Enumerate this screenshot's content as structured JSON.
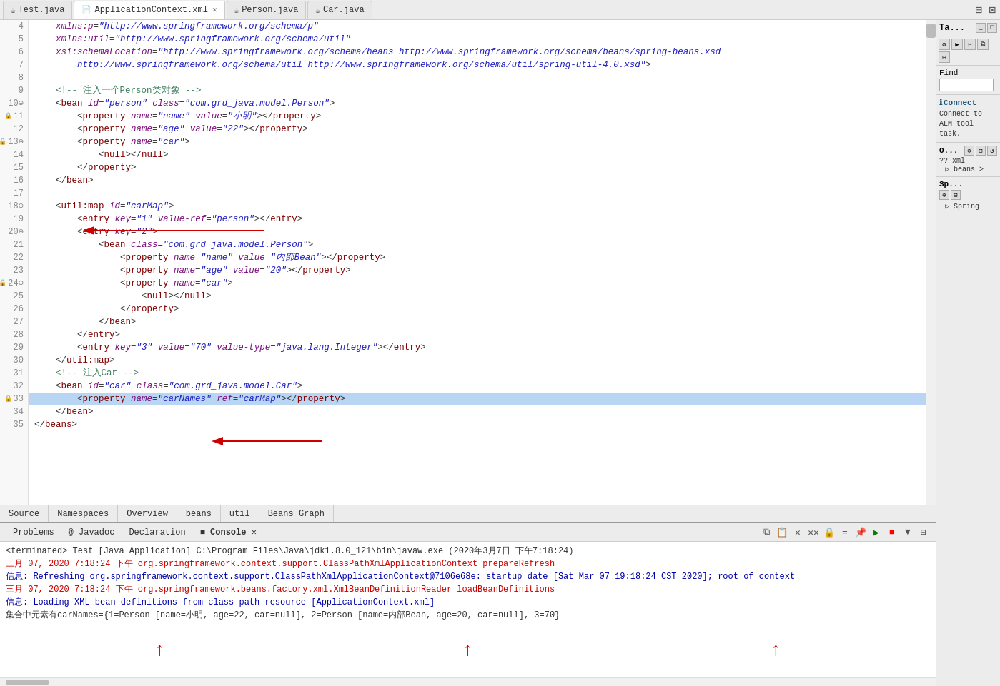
{
  "tabs": [
    {
      "id": "test-java",
      "label": "Test.java",
      "icon": "☕",
      "closable": false,
      "active": false
    },
    {
      "id": "app-context",
      "label": "ApplicationContext.xml",
      "icon": "📄",
      "closable": true,
      "active": true
    },
    {
      "id": "person-java",
      "label": "Person.java",
      "icon": "☕",
      "closable": false,
      "active": false
    },
    {
      "id": "car-java",
      "label": "Car.java",
      "icon": "☕",
      "closable": false,
      "active": false
    }
  ],
  "editor": {
    "lines": [
      {
        "num": 4,
        "marker": "",
        "text": "    xmlns:p=\"http://www.springframework.org/schema/p\""
      },
      {
        "num": 5,
        "marker": "",
        "text": "    xmlns:util=\"http://www.springframework.org/schema/util\""
      },
      {
        "num": 6,
        "marker": "",
        "text": "    xsi:schemaLocation=\"http://www.springframework.org/schema/beans http://www.springframework.org/schema/beans/spring-beans.xsd"
      },
      {
        "num": 7,
        "marker": "",
        "text": "    http://www.springframework.org/schema/util http://www.springframework.org/schema/util/spring-util-4.0.xsd\">"
      },
      {
        "num": 8,
        "marker": "",
        "text": ""
      },
      {
        "num": 9,
        "marker": "",
        "text": "    <!-- 注入一个Person类对象 -->"
      },
      {
        "num": 10,
        "marker": "",
        "text": "    <bean id=\"person\" class=\"com.grd_java.model.Person\">"
      },
      {
        "num": 11,
        "marker": "🔒",
        "text": "        <property name=\"name\" value=\"小明\"></property>"
      },
      {
        "num": 12,
        "marker": "",
        "text": "        <property name=\"age\" value=\"22\"></property>"
      },
      {
        "num": 13,
        "marker": "🔒",
        "text": "        <property name=\"car\">"
      },
      {
        "num": 14,
        "marker": "",
        "text": "            <null></null>"
      },
      {
        "num": 15,
        "marker": "",
        "text": "        </property>"
      },
      {
        "num": 16,
        "marker": "",
        "text": "    </bean>"
      },
      {
        "num": 17,
        "marker": "",
        "text": ""
      },
      {
        "num": 18,
        "marker": "",
        "text": "    <util:map id=\"carMap\">"
      },
      {
        "num": 19,
        "marker": "",
        "text": "        <entry key=\"1\" value-ref=\"person\"></entry>"
      },
      {
        "num": 20,
        "marker": "",
        "text": "        <entry key=\"2\">"
      },
      {
        "num": 21,
        "marker": "",
        "text": "            <bean class=\"com.grd_java.model.Person\">"
      },
      {
        "num": 22,
        "marker": "",
        "text": "                <property name=\"name\" value=\"内部Bean\"></property>"
      },
      {
        "num": 23,
        "marker": "",
        "text": "                <property name=\"age\" value=\"20\"></property>"
      },
      {
        "num": 24,
        "marker": "🔒",
        "text": "                <property name=\"car\">"
      },
      {
        "num": 25,
        "marker": "",
        "text": "                    <null></null>"
      },
      {
        "num": 26,
        "marker": "",
        "text": "                </property>"
      },
      {
        "num": 27,
        "marker": "",
        "text": "            </bean>"
      },
      {
        "num": 28,
        "marker": "",
        "text": "        </entry>"
      },
      {
        "num": 29,
        "marker": "",
        "text": "        <entry key=\"3\" value=\"70\" value-type=\"java.lang.Integer\"></entry>"
      },
      {
        "num": 30,
        "marker": "",
        "text": "    </util:map>"
      },
      {
        "num": 31,
        "marker": "",
        "text": "    <!-- 注入Car -->"
      },
      {
        "num": 32,
        "marker": "",
        "text": "    <bean id=\"car\" class=\"com.grd_java.model.Car\">"
      },
      {
        "num": 33,
        "marker": "🔒",
        "text": "        <property name=\"carNames\" ref=\"carMap\"></property>",
        "selected": true
      },
      {
        "num": 34,
        "marker": "",
        "text": "    </bean>"
      },
      {
        "num": 35,
        "marker": "",
        "text": "</beans>"
      }
    ]
  },
  "bottom_tabs": [
    {
      "label": "Source",
      "active": false
    },
    {
      "label": "Namespaces",
      "active": false
    },
    {
      "label": "Overview",
      "active": false
    },
    {
      "label": "beans",
      "active": false
    },
    {
      "label": "util",
      "active": false
    },
    {
      "label": "Beans Graph",
      "active": false
    }
  ],
  "console": {
    "header_tabs": [
      {
        "label": "Problems",
        "active": false
      },
      {
        "label": "@ Javadoc",
        "active": false
      },
      {
        "label": "Declaration",
        "active": false
      },
      {
        "label": "Console",
        "active": true
      }
    ],
    "title": "<terminated> Test [Java Application] C:\\Program Files\\Java\\jdk1.8.0_121\\bin\\javaw.exe (2020年3月7日 下午7:18:24)",
    "lines": [
      {
        "type": "error",
        "text": "三月 07, 2020 7:18:24 下午 org.springframework.context.support.ClassPathXmlApplicationContext prepareRefresh"
      },
      {
        "type": "info",
        "text": "信息: Refreshing org.springframework.context.support.ClassPathXmlApplicationContext@7106e68e: startup date [Sat Mar 07 19:18:24 CST 2020]; root of context"
      },
      {
        "type": "error",
        "text": "三月 07, 2020 7:18:24 下午 org.springframework.beans.factory.xml.XmlBeanDefinitionReader loadBeanDefinitions"
      },
      {
        "type": "info",
        "text": "信息: Loading XML bean definitions from class path resource [ApplicationContext.xml]"
      },
      {
        "type": "output",
        "text": "集合中元素有carNames={1=Person [name=小明, age=22, car=null], 2=Person [name=内部Bean, age=20, car=null], 3=70}"
      }
    ]
  },
  "right_panel": {
    "title": "Ta...",
    "find_label": "Find",
    "find_placeholder": "",
    "connect_title": "Connect",
    "connect_text": "Connect to ALM tool task.",
    "outline_title": "O...",
    "outline_subtitle": "?? xml",
    "outline_items": [
      {
        "label": "beans >"
      }
    ],
    "spring_label": "Sp...",
    "spring_child": "Spring"
  }
}
